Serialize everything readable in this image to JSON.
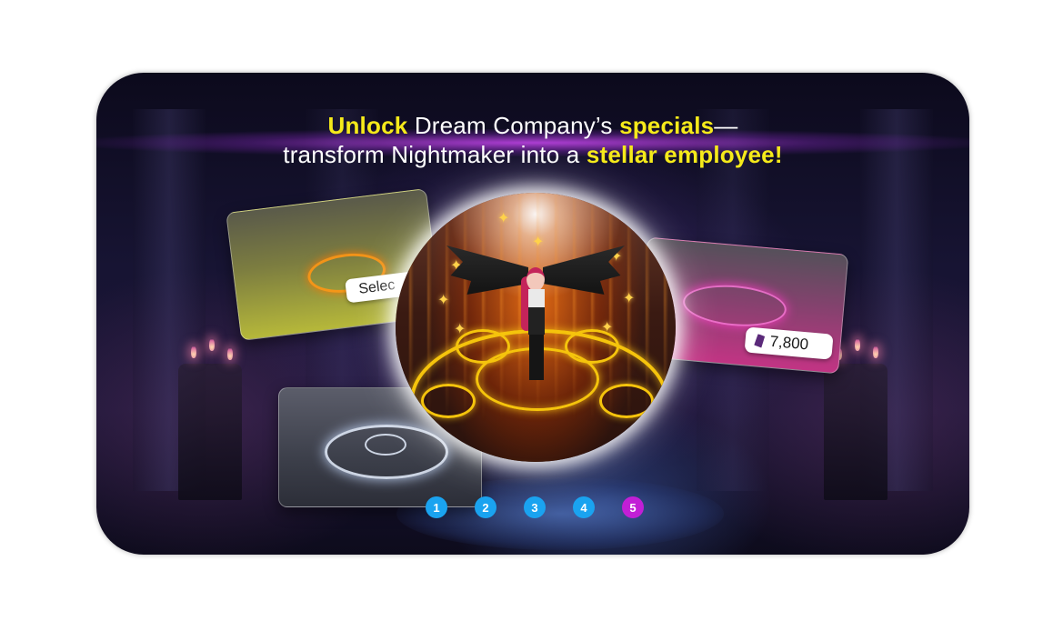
{
  "headline": {
    "line1": {
      "w1": "Unlock",
      "w2": " Dream Company’s ",
      "w3": "specials",
      "w4": "—"
    },
    "line2": {
      "w1": "transform Nightmaker into a ",
      "w2": "stellar employee!"
    }
  },
  "cards": {
    "yellow": {
      "button_label": "Selec"
    },
    "pink": {
      "price": "7,800",
      "currency_icon": "crystal-gem-icon"
    }
  },
  "pager": {
    "pages": [
      "1",
      "2",
      "3",
      "4",
      "5"
    ],
    "active_page": "5"
  },
  "colors": {
    "highlight": "#f5ea1a",
    "pager_default": "#1aa3f0",
    "pager_active": "#c21fd6",
    "magic_circle": "#f5c40c"
  }
}
